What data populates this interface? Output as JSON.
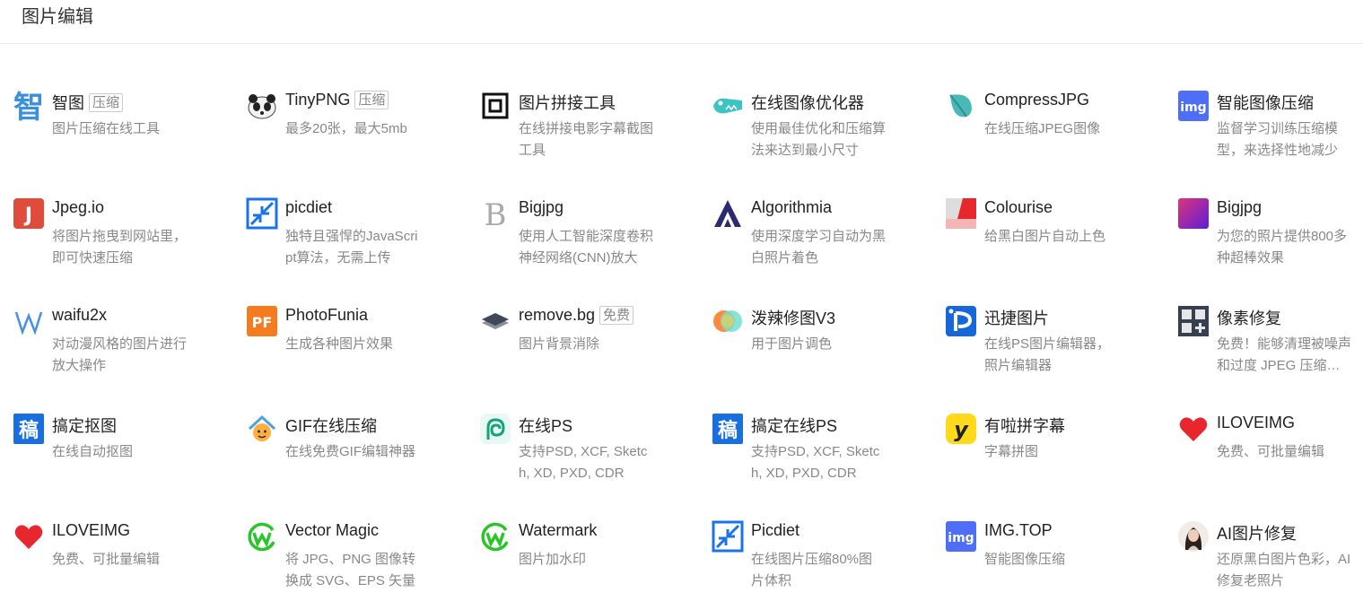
{
  "header": {
    "title": "图片编辑"
  },
  "tools": [
    {
      "name": "智图",
      "tag": "压缩",
      "desc": "图片压缩在线工具",
      "icon": "zhitu-logo-icon"
    },
    {
      "name": "TinyPNG",
      "tag": "压缩",
      "desc": "最多20张，最大5mb",
      "icon": "panda-logo-icon"
    },
    {
      "name": "图片拼接工具",
      "tag": "",
      "desc": "在线拼接电影字幕截图工具",
      "icon": "square-frame-icon"
    },
    {
      "name": "在线图像优化器",
      "tag": "",
      "desc": "使用最佳优化和压缩算法来达到最小尺寸",
      "icon": "crocodile-logo-icon"
    },
    {
      "name": "CompressJPG",
      "tag": "",
      "desc": "在线压缩JPEG图像",
      "icon": "leaf-logo-icon"
    },
    {
      "name": "智能图像压缩",
      "tag": "",
      "desc": "监督学习训练压缩模型，来选择性地减少",
      "icon": "img-logo-icon"
    },
    {
      "name": "Jpeg.io",
      "tag": "",
      "desc": "将图片拖曳到网站里，即可快速压缩",
      "icon": "j-logo-icon"
    },
    {
      "name": "picdiet",
      "tag": "",
      "desc": "独特且强悍的JavaScript算法，无需上传",
      "icon": "shrink-arrows-icon"
    },
    {
      "name": "Bigjpg",
      "tag": "",
      "desc": "使用人工智能深度卷积神经网络(CNN)放大",
      "icon": "b-letter-logo-icon"
    },
    {
      "name": "Algorithmia",
      "tag": "",
      "desc": "使用深度学习自动为黑白照片着色",
      "icon": "algorithmia-logo-icon"
    },
    {
      "name": "Colourise",
      "tag": "",
      "desc": "给黑白图片自动上色",
      "icon": "colourise-logo-icon"
    },
    {
      "name": "Bigjpg",
      "tag": "",
      "desc": "为您的照片提供800多种超棒效果",
      "icon": "gradient-square-icon"
    },
    {
      "name": "waifu2x",
      "tag": "",
      "desc": "对动漫风格的图片进行放大操作",
      "icon": "w-logo-icon"
    },
    {
      "name": "PhotoFunia",
      "tag": "",
      "desc": "生成各种图片效果",
      "icon": "pf-logo-icon"
    },
    {
      "name": "remove.bg",
      "tag": "免费",
      "desc": "图片背景消除",
      "icon": "layers-logo-icon"
    },
    {
      "name": "泼辣修图V3",
      "tag": "",
      "desc": "用于图片调色",
      "icon": "polarr-logo-icon"
    },
    {
      "name": "迅捷图片",
      "tag": "",
      "desc": "在线PS图片编辑器，照片编辑器",
      "icon": "p-logo-icon"
    },
    {
      "name": "像素修复",
      "tag": "",
      "desc": "免费！能够清理被噪声和过度 JPEG 压缩损坏",
      "icon": "pixel-grid-plus-icon"
    },
    {
      "name": "搞定抠图",
      "tag": "",
      "desc": "在线自动抠图",
      "icon": "gao-logo-icon"
    },
    {
      "name": "GIF在线压缩",
      "tag": "",
      "desc": "在线免费GIF编辑神器",
      "icon": "house-face-logo-icon"
    },
    {
      "name": "在线PS",
      "tag": "",
      "desc": "支持PSD, XCF, Sketch, XD, PXD, CDR",
      "icon": "spiral-logo-icon"
    },
    {
      "name": "搞定在线PS",
      "tag": "",
      "desc": "支持PSD, XCF, Sketch, XD, PXD, CDR",
      "icon": "gao-logo-icon"
    },
    {
      "name": "有啦拼字幕",
      "tag": "",
      "desc": "字幕拼图",
      "icon": "y-logo-icon"
    },
    {
      "name": "ILOVEIMG",
      "tag": "",
      "desc": "免费、可批量编辑",
      "icon": "heart-icon"
    },
    {
      "name": "ILOVEIMG",
      "tag": "",
      "desc": "免费、可批量编辑",
      "icon": "heart-icon"
    },
    {
      "name": "Vector Magic",
      "tag": "",
      "desc": "将 JPG、PNG 图像转换成 SVG、EPS 矢量",
      "icon": "green-w-circle-icon"
    },
    {
      "name": "Watermark",
      "tag": "",
      "desc": "图片加水印",
      "icon": "green-w-circle-icon"
    },
    {
      "name": "Picdiet",
      "tag": "",
      "desc": "在线图片压缩80%图片体积",
      "icon": "shrink-arrows-icon"
    },
    {
      "name": "IMG.TOP",
      "tag": "",
      "desc": "智能图像压缩",
      "icon": "img-logo-icon"
    },
    {
      "name": "AI图片修复",
      "tag": "",
      "desc": "还原黑白图片色彩，AI修复老照片",
      "icon": "portrait-avatar-icon"
    }
  ],
  "colors": {
    "accent_blue": "#1a73e8",
    "heart_red": "#e8262d",
    "green": "#2bc52b"
  }
}
